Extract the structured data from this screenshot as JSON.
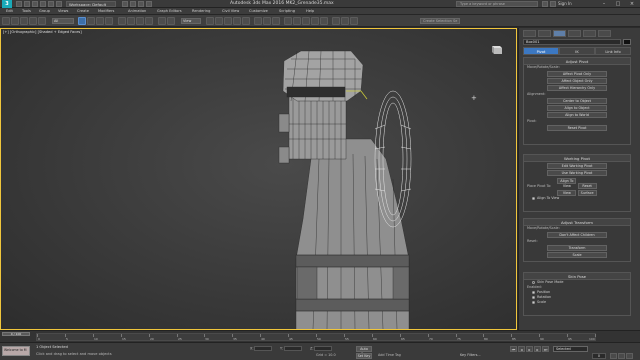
{
  "titlebar": {
    "logo": "3",
    "workspace": "Workspace: Default",
    "title": "Autodesk 3ds Max 2016      MK2_Grenade35.max",
    "search_placeholder": "Type a keyword or phrase",
    "signin": "Sign In",
    "minimize": "–",
    "maximize": "□",
    "close": "×"
  },
  "menus": [
    "Edit",
    "Tools",
    "Group",
    "Views",
    "Create",
    "Modifiers",
    "Animation",
    "Graph Editors",
    "Rendering",
    "Civil View",
    "Customize",
    "Scripting",
    "Help"
  ],
  "toolbar": {
    "selection_filter": "All",
    "reference_coord": "View",
    "named_selection": "Create Selection Se"
  },
  "viewport": {
    "label": "[+] [Orthographic] [Shaded + Edged Faces]",
    "cursor": "+"
  },
  "command_panel": {
    "object_name": "Box001",
    "tabs": [
      "create",
      "modify",
      "hierarchy",
      "motion",
      "display",
      "utilities"
    ],
    "active_tab": 2,
    "hier_tabs": [
      "Pivot",
      "IK",
      "Link Info"
    ],
    "adjust_pivot": {
      "title": "Adjust Pivot",
      "move_label": "Move/Rotate/Scale:",
      "buttons": [
        "Affect Pivot Only",
        "Affect Object Only",
        "Affect Hierarchy Only"
      ],
      "alignment_label": "Alignment:",
      "align_buttons": [
        "Center to Object",
        "Align to Object",
        "Align to World"
      ],
      "pivot_label": "Pivot:",
      "reset_button": "Reset Pivot"
    },
    "working_pivot": {
      "title": "Working Pivot",
      "buttons": [
        "Edit Working Pivot",
        "Use Working Pivot"
      ],
      "small_buttons": [
        "Align To View",
        "Reset"
      ],
      "place_label": "Place Pivot To:",
      "view_btn": "View",
      "surface_btn": "Surface",
      "align_view_check": "Align To View"
    },
    "adjust_transform": {
      "title": "Adjust Transform",
      "move_label": "Move/Rotate/Scale:",
      "dont_affect": "Don't Affect Children",
      "reset_label": "Reset:",
      "reset_buttons": [
        "Transform",
        "Scale"
      ]
    },
    "skin_pose": {
      "title": "Skin Pose",
      "enabled": "Skin Pose Mode",
      "enabled_label": "Enabled:",
      "options": [
        "Position",
        "Rotation",
        "Scale"
      ]
    }
  },
  "timeline": {
    "frame_label": "0 / 100",
    "ticks": [
      "0",
      "5",
      "10",
      "15",
      "20",
      "25",
      "30",
      "35",
      "40",
      "45",
      "50",
      "55",
      "60",
      "65",
      "70",
      "75",
      "80",
      "85",
      "90",
      "95",
      "100"
    ]
  },
  "statusbar": {
    "maxscript": "Welcome to M",
    "status_1": "1 Object Selected",
    "status_2": "Click and drag to select and move objects",
    "x_label": "X:",
    "y_label": "Y:",
    "z_label": "Z:",
    "grid": "Grid = 10.0",
    "autokey": "Auto Key",
    "setkey": "Set Key",
    "selected": "Selected",
    "keyfilters": "Key Filters...",
    "add_time_tag": "Add Time Tag",
    "frame": "0"
  }
}
